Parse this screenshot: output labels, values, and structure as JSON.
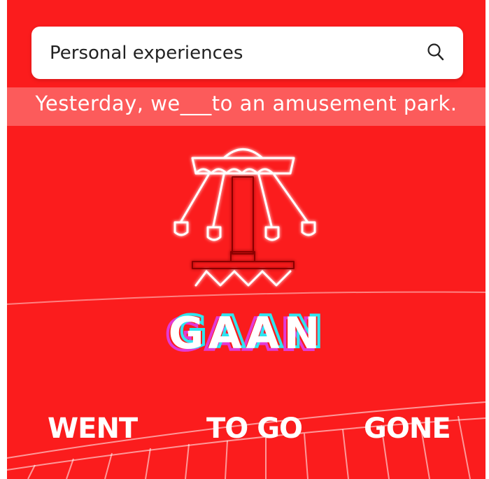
{
  "search": {
    "value": "Personal experiences",
    "icon": "search-icon"
  },
  "question": {
    "text": "Yesterday, we___to an amusement park."
  },
  "illustration": {
    "icon": "swing-ride-icon"
  },
  "word": {
    "text": "GAAN"
  },
  "answers": [
    {
      "label": "WENT"
    },
    {
      "label": "TO GO"
    },
    {
      "label": "GONE"
    }
  ],
  "colors": {
    "background": "#fb1c1d",
    "glow_white": "#ffffff",
    "cyan": "#2ee6f0",
    "magenta": "#e23ad6"
  }
}
